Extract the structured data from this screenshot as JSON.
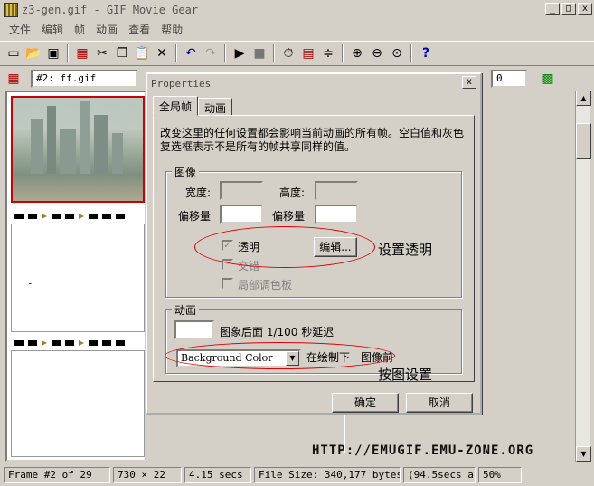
{
  "window": {
    "title": "z3-gen.gif - GIF Movie Gear",
    "min": "_",
    "max": "□",
    "close": "x"
  },
  "menu": [
    "文件",
    "编辑",
    "帧",
    "动画",
    "查看",
    "帮助"
  ],
  "toolbar2": {
    "frame_combo": "#2: ff.gif",
    "right_value": "0"
  },
  "dialog": {
    "title": "Properties",
    "close": "x",
    "tabs": [
      "全局帧",
      "动画"
    ],
    "description": "改变这里的任何设置都会影响当前动画的所有帧。空白值和灰色复选框表示不是所有的帧共享同样的值。",
    "image_group": {
      "label": "图像",
      "width_label": "宽度:",
      "height_label": "高度:",
      "offset_x_label": "偏移量",
      "offset_y_label": "偏移量",
      "transparent_label": "透明",
      "transparent_checked": true,
      "edit_button": "编辑...",
      "interlace_label": "交错",
      "local_palette_label": "局部调色板"
    },
    "anim_group": {
      "label": "动画",
      "delay_text": "图象后面 1/100 秒延迟",
      "disposal_value": "Background Color",
      "disposal_suffix": "在绘制下一图像前"
    },
    "ok": "确定",
    "cancel": "取消"
  },
  "annotations": {
    "transparent": "设置透明",
    "disposal": "按图设置"
  },
  "watermark": "HTTP://EMUGIF.EMU-ZONE.ORG",
  "status": {
    "frame": "Frame #2 of 29",
    "size": "730 × 22",
    "duration": "4.15 secs",
    "filesize": "File Size: 340,177 bytes",
    "extra": "(94.5secs a",
    "zoom": "50%"
  },
  "colors": {
    "annotation_ellipse": "#e00000",
    "selected_frame_border": "#cc0000"
  }
}
